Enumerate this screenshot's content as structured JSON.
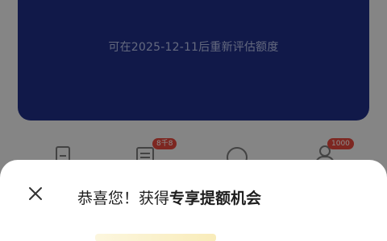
{
  "credit_card": {
    "reassess_note": "可在2025-12-11后重新评估额度",
    "background_color": "#1f2f86"
  },
  "shortcuts": {
    "items": [
      {
        "icon": "document-icon"
      },
      {
        "icon": "list-icon",
        "badge": "8千8"
      },
      {
        "icon": "chat-bubble-icon"
      },
      {
        "icon": "user-icon",
        "badge": "1000"
      }
    ]
  },
  "dialog": {
    "title_prefix": "恭喜您！获得",
    "title_highlight": "专享提额机会",
    "close_icon": "close-icon"
  },
  "colors": {
    "badge": "#e4473d",
    "overlay": "rgba(0,0,0,0.45)"
  }
}
